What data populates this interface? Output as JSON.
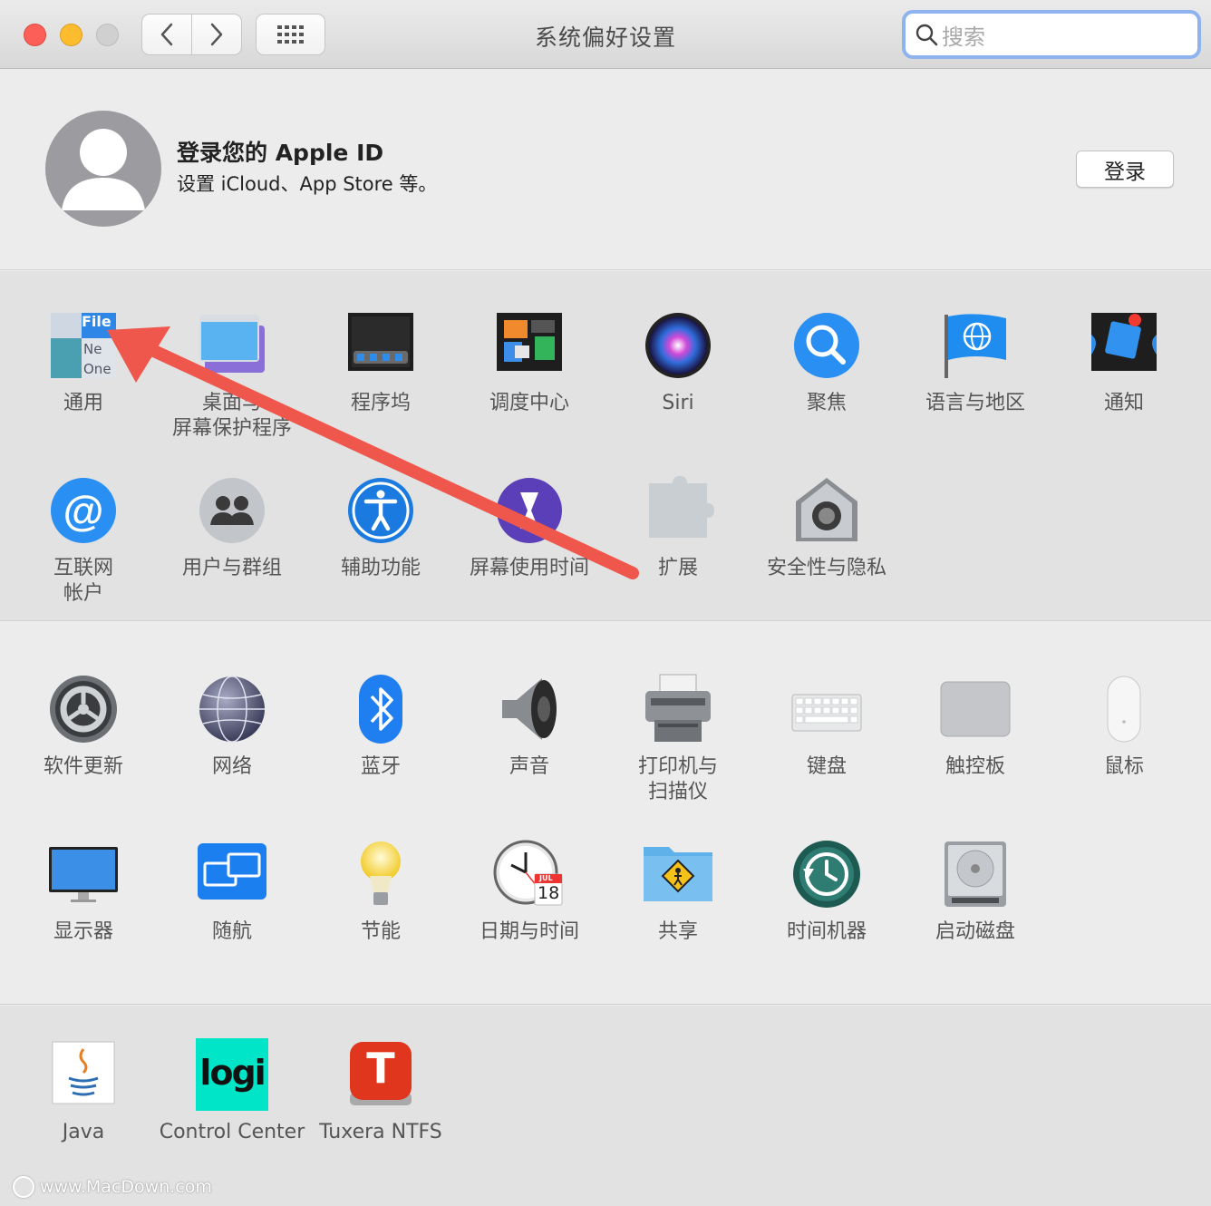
{
  "window": {
    "title": "系统偏好设置"
  },
  "search": {
    "placeholder": "搜索"
  },
  "apple_id": {
    "title": "登录您的 Apple ID",
    "subtitle": "设置 iCloud、App Store 等。",
    "login_label": "登录"
  },
  "section1": {
    "items": [
      {
        "label": "通用",
        "icon": "general-icon"
      },
      {
        "label": "桌面与\n屏幕保护程序",
        "icon": "desktop-screensaver-icon"
      },
      {
        "label": "程序坞",
        "icon": "dock-icon"
      },
      {
        "label": "调度中心",
        "icon": "mission-control-icon"
      },
      {
        "label": "Siri",
        "icon": "siri-icon"
      },
      {
        "label": "聚焦",
        "icon": "spotlight-icon"
      },
      {
        "label": "语言与地区",
        "icon": "language-region-icon"
      },
      {
        "label": "通知",
        "icon": "notifications-icon"
      },
      {
        "label": "互联网\n帐户",
        "icon": "internet-accounts-icon"
      },
      {
        "label": "用户与群组",
        "icon": "users-groups-icon"
      },
      {
        "label": "辅助功能",
        "icon": "accessibility-icon"
      },
      {
        "label": "屏幕使用时间",
        "icon": "screen-time-icon"
      },
      {
        "label": "扩展",
        "icon": "extensions-icon"
      },
      {
        "label": "安全性与隐私",
        "icon": "security-privacy-icon"
      }
    ]
  },
  "section2": {
    "items": [
      {
        "label": "软件更新",
        "icon": "software-update-icon"
      },
      {
        "label": "网络",
        "icon": "network-icon"
      },
      {
        "label": "蓝牙",
        "icon": "bluetooth-icon"
      },
      {
        "label": "声音",
        "icon": "sound-icon"
      },
      {
        "label": "打印机与\n扫描仪",
        "icon": "printer-scanner-icon"
      },
      {
        "label": "键盘",
        "icon": "keyboard-icon"
      },
      {
        "label": "触控板",
        "icon": "trackpad-icon"
      },
      {
        "label": "鼠标",
        "icon": "mouse-icon"
      },
      {
        "label": "显示器",
        "icon": "displays-icon"
      },
      {
        "label": "随航",
        "icon": "sidecar-icon"
      },
      {
        "label": "节能",
        "icon": "energy-saver-icon"
      },
      {
        "label": "日期与时间",
        "icon": "date-time-icon"
      },
      {
        "label": "共享",
        "icon": "sharing-icon"
      },
      {
        "label": "时间机器",
        "icon": "time-machine-icon"
      },
      {
        "label": "启动磁盘",
        "icon": "startup-disk-icon"
      }
    ]
  },
  "section3": {
    "items": [
      {
        "label": "Java",
        "icon": "java-icon"
      },
      {
        "label": "Control Center",
        "icon": "logi-control-center-icon"
      },
      {
        "label": "Tuxera NTFS",
        "icon": "tuxera-ntfs-icon"
      }
    ]
  },
  "icon_text": {
    "general_file": "File",
    "general_ne": "Ne",
    "general_one": "One",
    "logi": "logi",
    "tuxera": "T",
    "calendar_month": "JUL",
    "calendar_day": "18"
  },
  "watermark": "www.MacDown.com",
  "annotation": {
    "arrow_color": "#f0574c"
  }
}
